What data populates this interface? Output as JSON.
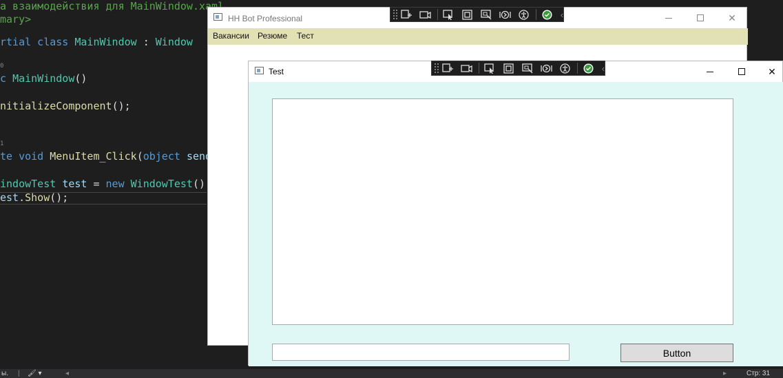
{
  "editor": {
    "lines": [
      "а взаимодействия для MainWindow.xaml",
      "mary>",
      "rtial class MainWindow : Window",
      "c MainWindow()",
      "nitializeComponent();",
      "te void MenuItem_Click(object send",
      "indowTest test = new WindowTest()",
      "est.Show();"
    ],
    "ref_counts": [
      "0",
      "1"
    ]
  },
  "statusbar": {
    "left_text": "ы.",
    "line_indicator": "Стр: 31"
  },
  "main_window": {
    "title": "HH Bot Professional",
    "menu": [
      "Вакансии",
      "Резюме",
      "Тест"
    ],
    "background": "#ffffff",
    "menubar_color": "#e2e1b6"
  },
  "test_window": {
    "title": "Test",
    "button_label": "Button",
    "textbox_value": "",
    "client_color": "#e0f8f5"
  },
  "debug_toolbar": {
    "tools": [
      "go-to-live-visual-tree-icon",
      "show-in-app-toolbar-icon",
      "select-element-icon",
      "display-layout-adorners-icon",
      "track-focused-element-icon",
      "hot-reload-icon",
      "accessibility-checker-icon",
      "checkmark-icon",
      "collapse-chevron-icon"
    ]
  }
}
